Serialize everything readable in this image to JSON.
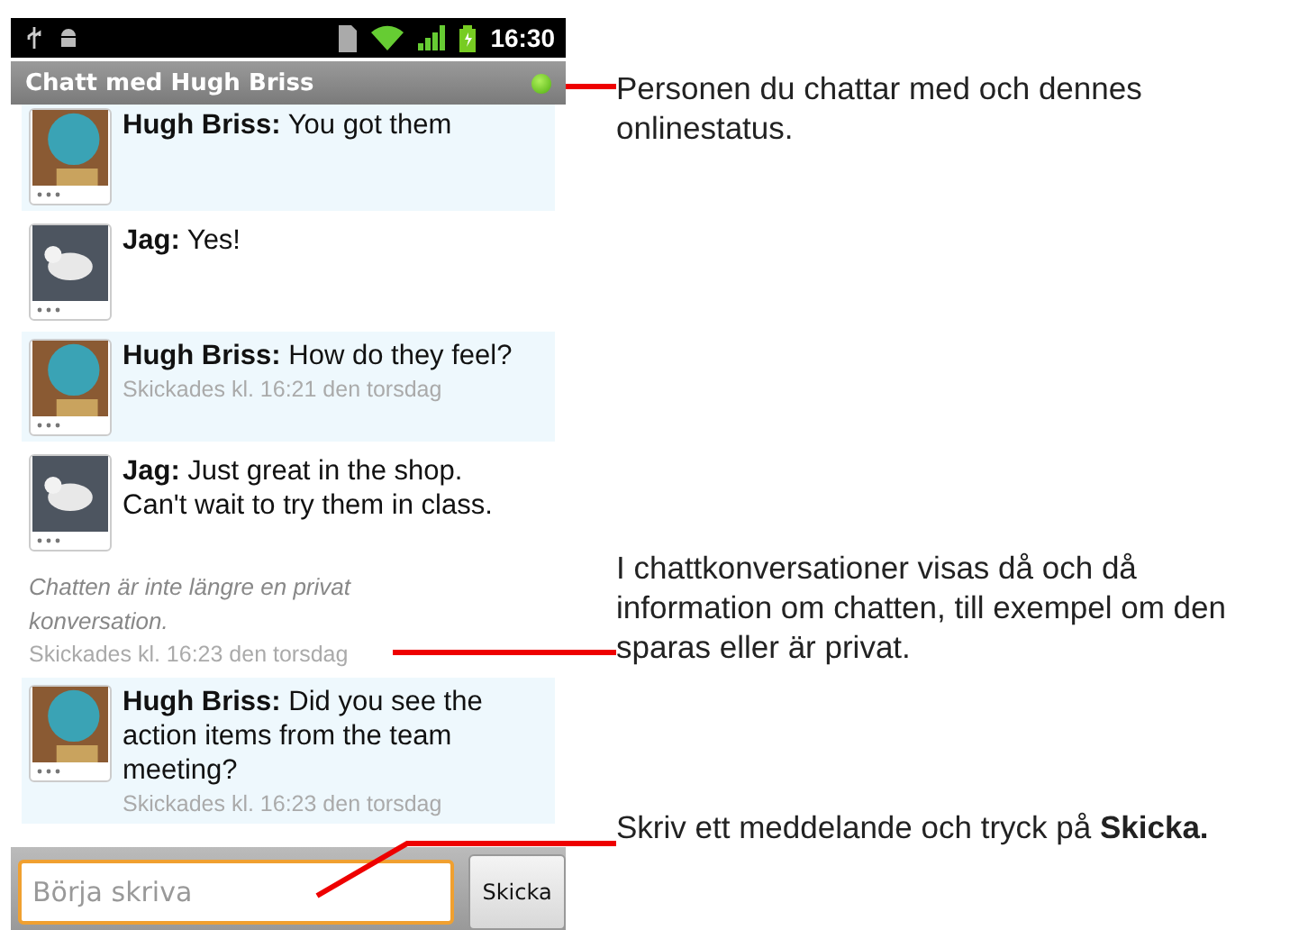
{
  "status_bar": {
    "time": "16:30"
  },
  "title_bar": {
    "title": "Chatt med Hugh Briss",
    "online": true
  },
  "messages": [
    {
      "kind": "incoming",
      "text": "**Hugh Briss:** You got them"
    },
    {
      "kind": "outgoing",
      "text": "**Jag:** Yes!"
    },
    {
      "kind": "incoming",
      "text": "**Hugh Briss:** How do they feel?",
      "sent": "Skickades kl. 16:21 den torsdag"
    },
    {
      "kind": "outgoing",
      "text": "**Jag:** Just great in the shop. Can't wait to try them in class."
    },
    {
      "kind": "notice",
      "text": "Chatten är inte längre en privat konversation.",
      "sent": "Skickades kl. 16:23 den torsdag"
    },
    {
      "kind": "incoming",
      "text": "**Hugh Briss:** Did you see the action items from the team meeting?",
      "sent": "Skickades kl. 16:23 den torsdag"
    }
  ],
  "composer": {
    "placeholder": "Börja skriva",
    "send": "Skicka"
  },
  "callouts": [
    {
      "text": "Personen du chattar med och dennes onlinestatus."
    },
    {
      "text": "I chattkonversationer visas då och då information om chatten, till exempel om den sparas eller är privat."
    },
    {
      "text": "Skriv ett meddelande och tryck på **Skicka.**"
    }
  ]
}
